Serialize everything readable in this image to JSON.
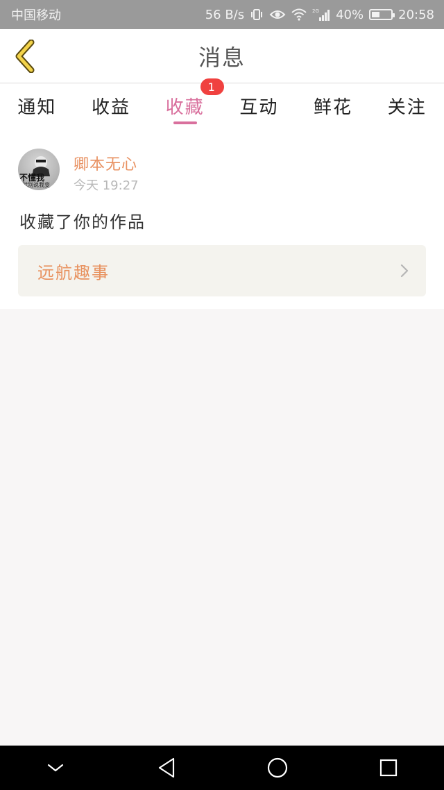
{
  "status_bar": {
    "carrier": "中国移动",
    "net_speed": "56 B/s",
    "battery_text": "40%",
    "battery_level": 0.4,
    "time": "20:58",
    "network_label": "2G"
  },
  "header": {
    "title": "消息",
    "back_icon": "chevron-left-icon"
  },
  "tabs": [
    {
      "label": "通知",
      "active": false
    },
    {
      "label": "收益",
      "active": false
    },
    {
      "label": "收藏",
      "active": true,
      "badge": "1"
    },
    {
      "label": "互动",
      "active": false
    },
    {
      "label": "鲜花",
      "active": false
    },
    {
      "label": "关注",
      "active": false
    }
  ],
  "message": {
    "avatar_text": "不懂我",
    "avatar_subtext": "就别说我变",
    "sender": "卿本无心",
    "time": "今天 19:27",
    "text": "收藏了你的作品",
    "work_title": "远航趣事"
  },
  "colors": {
    "accent_pink": "#d9709d",
    "accent_orange": "#e8915e",
    "badge_red": "#f0413f",
    "back_arrow": "#f3d34a"
  },
  "nav": {
    "icons": [
      "chevron-down-icon",
      "back-triangle-icon",
      "home-circle-icon",
      "recents-square-icon"
    ]
  }
}
